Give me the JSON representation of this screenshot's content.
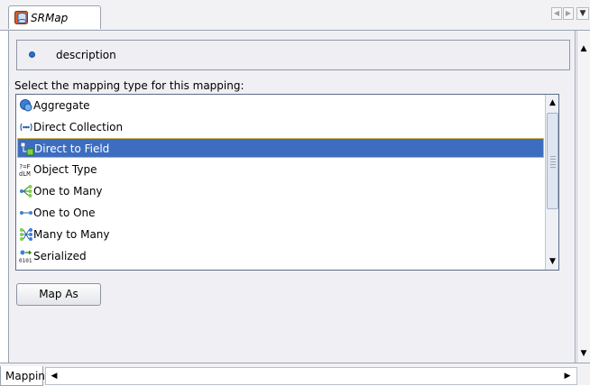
{
  "tab": {
    "title": "SRMap",
    "icon": "srmap-icon"
  },
  "description": {
    "text": "description",
    "icon": "bullet-icon"
  },
  "prompt": "Select the mapping type for this mapping:",
  "mapping_types": [
    {
      "label": "Aggregate",
      "icon": "aggregate-icon",
      "selected": false
    },
    {
      "label": "Direct Collection",
      "icon": "direct-collection-icon",
      "selected": false
    },
    {
      "label": "Direct to Field",
      "icon": "direct-to-field-icon",
      "selected": true
    },
    {
      "label": "Object Type",
      "icon": "object-type-icon",
      "selected": false
    },
    {
      "label": "One to Many",
      "icon": "one-to-many-icon",
      "selected": false
    },
    {
      "label": "One to One",
      "icon": "one-to-one-icon",
      "selected": false
    },
    {
      "label": "Many to Many",
      "icon": "many-to-many-icon",
      "selected": false
    },
    {
      "label": "Serialized",
      "icon": "serialized-icon",
      "selected": false
    }
  ],
  "map_as_button": "Map As",
  "bottom_tab": "Mapping",
  "colors": {
    "selection": "#3c6dc0",
    "selection_border": "#d6b24c",
    "panel_bg": "#f0f0f4"
  }
}
